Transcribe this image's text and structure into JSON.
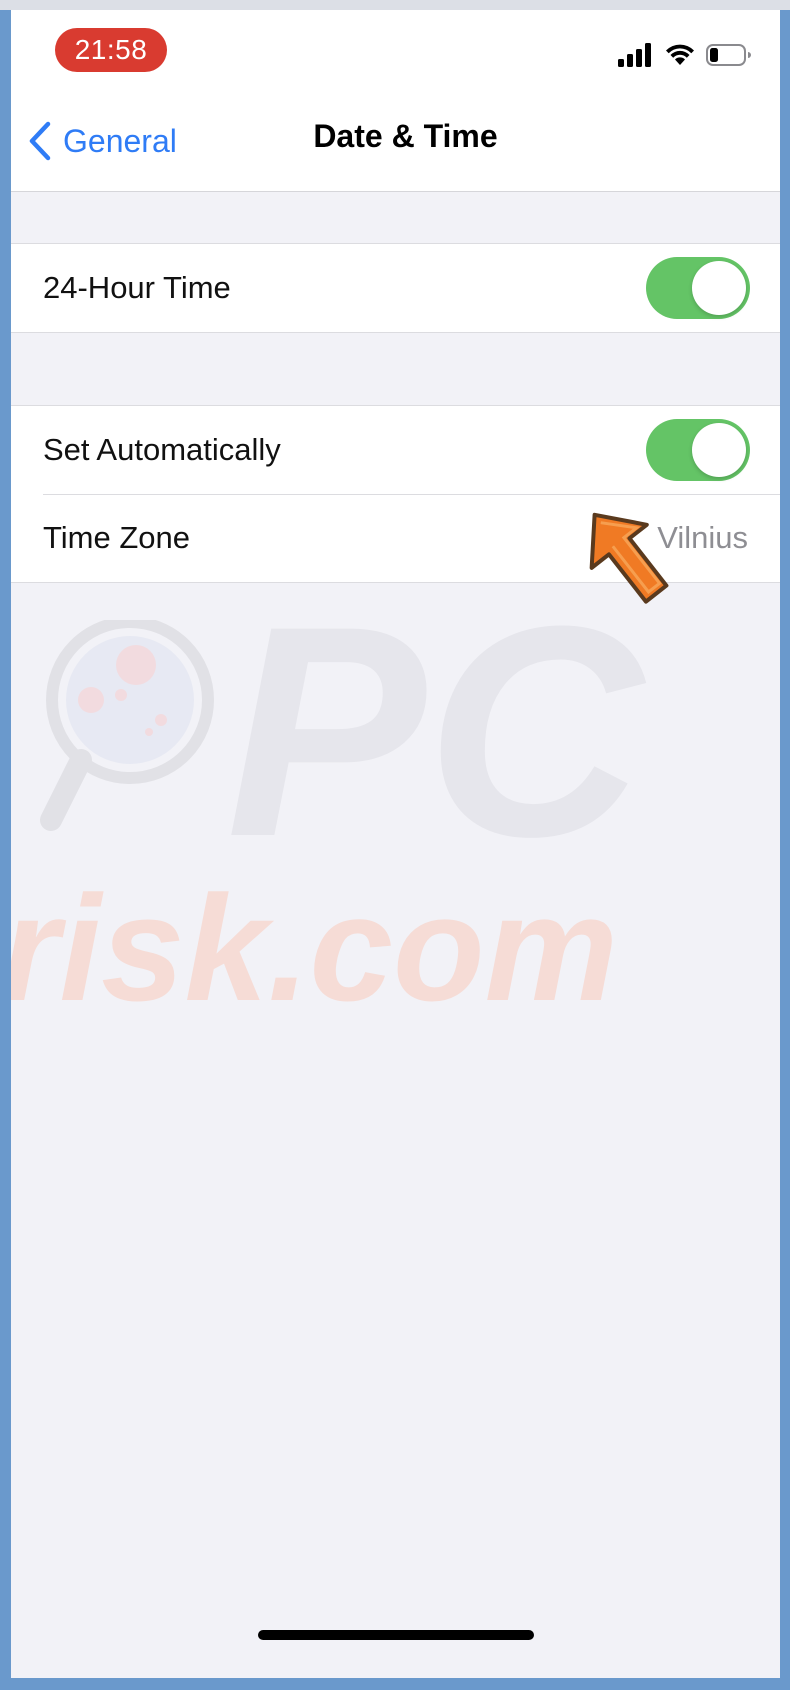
{
  "status_bar": {
    "time": "21:58",
    "icons": [
      "cellular-signal-icon",
      "wifi-icon",
      "battery-icon"
    ]
  },
  "nav": {
    "back_label": "General",
    "title": "Date & Time"
  },
  "settings": {
    "hour24": {
      "label": "24-Hour Time",
      "on": true
    },
    "set_automatically": {
      "label": "Set Automatically",
      "on": true
    },
    "time_zone": {
      "label": "Time Zone",
      "value": "Vilnius"
    }
  },
  "colors": {
    "accent": "#2f7cf6",
    "toggle_on": "#64c466",
    "time_pill": "#d93b30",
    "annotation_arrow": "#f07a24"
  },
  "watermark": {
    "text_top": "PC",
    "text_bottom": "risk.com"
  }
}
